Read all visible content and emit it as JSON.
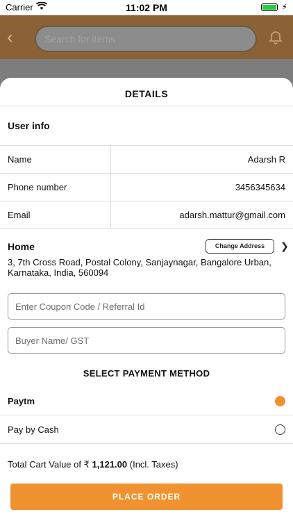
{
  "status_bar": {
    "carrier": "Carrier",
    "time": "11:02 PM"
  },
  "background": {
    "search_placeholder": "Search for items",
    "accent_color": "#8b6235"
  },
  "sheet": {
    "title": "DETAILS",
    "user_info": {
      "heading": "User info",
      "rows": [
        {
          "label": "Name",
          "value": "Adarsh R"
        },
        {
          "label": "Phone number",
          "value": "3456345634"
        },
        {
          "label": "Email",
          "value": "adarsh.mattur@gmail.com"
        }
      ]
    },
    "address": {
      "title": "Home",
      "change_label": "Change Address",
      "text": "3, 7th Cross Road, Postal Colony, Sanjaynagar, Bangalore Urban, Karnataka, India, 560094"
    },
    "coupon_placeholder": "Enter Coupon Code / Referral Id",
    "buyer_placeholder": "Buyer Name/ GST",
    "payment": {
      "title": "SELECT PAYMENT METHOD",
      "options": [
        {
          "label": "Paytm",
          "selected": true
        },
        {
          "label": "Pay by Cash",
          "selected": false
        }
      ]
    },
    "total": {
      "prefix": "Total Cart Value of",
      "currency": "₹",
      "amount": "1,121.00",
      "suffix": "(Incl. Taxes)"
    },
    "place_order_label": "PLACE ORDER",
    "accent_color": "#f0922f"
  }
}
